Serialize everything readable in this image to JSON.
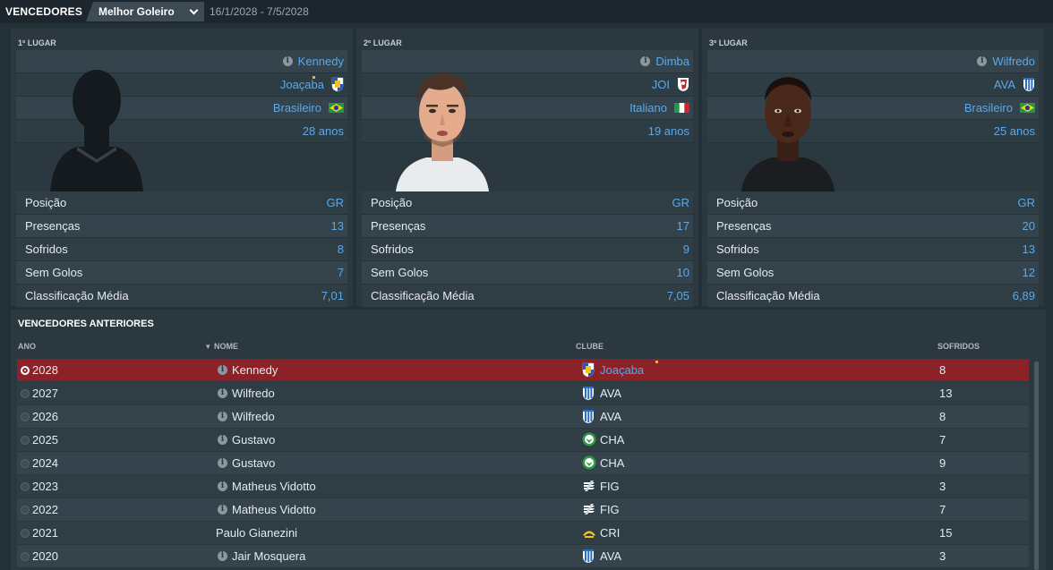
{
  "header": {
    "title": "VENCEDORES",
    "award": "Melhor Goleiro",
    "dates": "16/1/2028 - 7/5/2028"
  },
  "podium": [
    {
      "place": "1º LUGAR",
      "name": "Kennedy",
      "club": "Joaçaba",
      "nationality": "Brasileiro",
      "age": "28 anos",
      "stats": [
        {
          "label": "Posição",
          "value": "GR"
        },
        {
          "label": "Presenças",
          "value": "13"
        },
        {
          "label": "Sofridos",
          "value": "8"
        },
        {
          "label": "Sem Golos",
          "value": "7"
        },
        {
          "label": "Classificação Média",
          "value": "7,01"
        }
      ]
    },
    {
      "place": "2º LUGAR",
      "name": "Dimba",
      "club": "JOI",
      "nationality": "Italiano",
      "age": "19 anos",
      "stats": [
        {
          "label": "Posição",
          "value": "GR"
        },
        {
          "label": "Presenças",
          "value": "17"
        },
        {
          "label": "Sofridos",
          "value": "9"
        },
        {
          "label": "Sem Golos",
          "value": "10"
        },
        {
          "label": "Classificação Média",
          "value": "7,05"
        }
      ]
    },
    {
      "place": "3º LUGAR",
      "name": "Wilfredo",
      "club": "AVA",
      "nationality": "Brasileiro",
      "age": "25 anos",
      "stats": [
        {
          "label": "Posição",
          "value": "GR"
        },
        {
          "label": "Presenças",
          "value": "20"
        },
        {
          "label": "Sofridos",
          "value": "13"
        },
        {
          "label": "Sem Golos",
          "value": "12"
        },
        {
          "label": "Classificação Média",
          "value": "6,89"
        }
      ]
    }
  ],
  "previous": {
    "title": "VENCEDORES ANTERIORES",
    "columns": {
      "year": "ANO",
      "name": "NOME",
      "club": "CLUBE",
      "conceded": "SOFRIDOS"
    },
    "rows": [
      {
        "year": "2028",
        "name": "Kennedy",
        "club": "Joaçaba",
        "conceded": "8",
        "selected": true
      },
      {
        "year": "2027",
        "name": "Wilfredo",
        "club": "AVA",
        "conceded": "13"
      },
      {
        "year": "2026",
        "name": "Wilfredo",
        "club": "AVA",
        "conceded": "8"
      },
      {
        "year": "2025",
        "name": "Gustavo",
        "club": "CHA",
        "conceded": "7"
      },
      {
        "year": "2024",
        "name": "Gustavo",
        "club": "CHA",
        "conceded": "9"
      },
      {
        "year": "2023",
        "name": "Matheus Vidotto",
        "club": "FIG",
        "conceded": "3"
      },
      {
        "year": "2022",
        "name": "Matheus Vidotto",
        "club": "FIG",
        "conceded": "7"
      },
      {
        "year": "2021",
        "name": "Paulo Gianezini",
        "club": "CRI",
        "conceded": "15"
      },
      {
        "year": "2020",
        "name": "Jair Mosquera",
        "club": "AVA",
        "conceded": "3"
      }
    ]
  },
  "colors": {
    "accent": "#5ea8e6",
    "selected_row": "#8a2228",
    "background": "#233037"
  }
}
